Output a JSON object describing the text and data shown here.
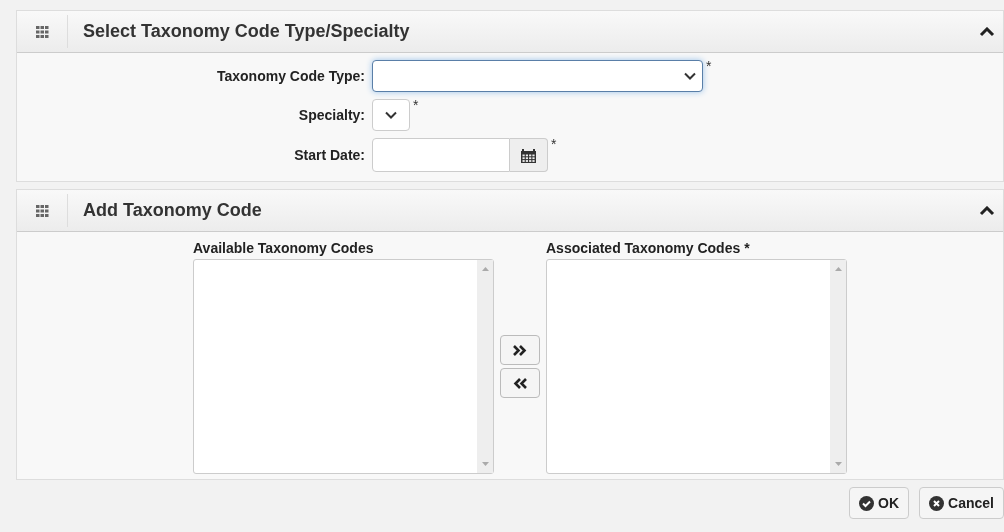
{
  "sections": [
    {
      "title": "Select Taxonomy Code Type/Specialty",
      "expanded": true,
      "kind": "form",
      "fields": [
        {
          "label": "Taxonomy Code Type:",
          "kind": "select",
          "required_mark": "*",
          "focused": true
        },
        {
          "label": "Specialty:",
          "kind": "select",
          "required_mark": "*",
          "focused": false
        },
        {
          "label": "Start Date:",
          "kind": "date",
          "required_mark": "*",
          "focused": false
        }
      ]
    },
    {
      "title": "Add Taxonomy Code",
      "expanded": true,
      "kind": "transfer",
      "lists": [
        {
          "label": "Available Taxonomy Codes"
        },
        {
          "label": "Associated Taxonomy Codes *"
        }
      ]
    }
  ],
  "buttons": [
    {
      "label": "OK",
      "kind": "ok"
    },
    {
      "label": "Cancel",
      "kind": "cancel"
    }
  ]
}
